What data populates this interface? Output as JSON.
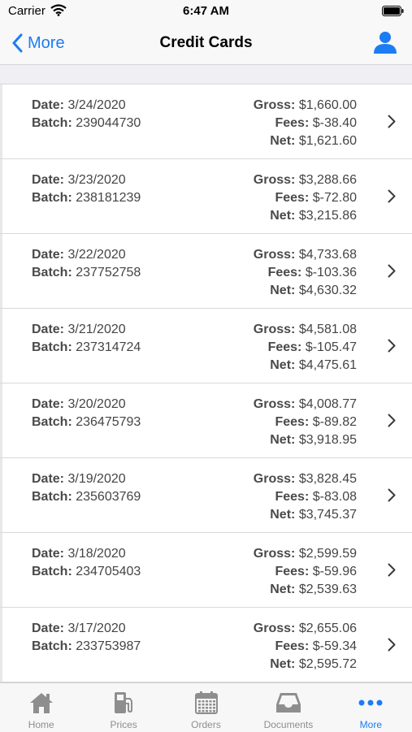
{
  "status_bar": {
    "carrier": "Carrier",
    "time": "6:47 AM"
  },
  "nav": {
    "back_label": "More",
    "title": "Credit Cards"
  },
  "labels": {
    "date": "Date:",
    "batch": "Batch:",
    "gross": "Gross:",
    "fees": "Fees:",
    "net": "Net:"
  },
  "batches": [
    {
      "date": "3/24/2020",
      "batch": "239044730",
      "gross": "$1,660.00",
      "fees": "$-38.40",
      "net": "$1,621.60"
    },
    {
      "date": "3/23/2020",
      "batch": "238181239",
      "gross": "$3,288.66",
      "fees": "$-72.80",
      "net": "$3,215.86"
    },
    {
      "date": "3/22/2020",
      "batch": "237752758",
      "gross": "$4,733.68",
      "fees": "$-103.36",
      "net": "$4,630.32"
    },
    {
      "date": "3/21/2020",
      "batch": "237314724",
      "gross": "$4,581.08",
      "fees": "$-105.47",
      "net": "$4,475.61"
    },
    {
      "date": "3/20/2020",
      "batch": "236475793",
      "gross": "$4,008.77",
      "fees": "$-89.82",
      "net": "$3,918.95"
    },
    {
      "date": "3/19/2020",
      "batch": "235603769",
      "gross": "$3,828.45",
      "fees": "$-83.08",
      "net": "$3,745.37"
    },
    {
      "date": "3/18/2020",
      "batch": "234705403",
      "gross": "$2,599.59",
      "fees": "$-59.96",
      "net": "$2,539.63"
    },
    {
      "date": "3/17/2020",
      "batch": "233753987",
      "gross": "$2,655.06",
      "fees": "$-59.34",
      "net": "$2,595.72"
    }
  ],
  "tabs": [
    {
      "label": "Home",
      "icon": "home-icon",
      "active": false
    },
    {
      "label": "Prices",
      "icon": "fuel-pump-icon",
      "active": false
    },
    {
      "label": "Orders",
      "icon": "calendar-icon",
      "active": false
    },
    {
      "label": "Documents",
      "icon": "inbox-tray-icon",
      "active": false
    },
    {
      "label": "More",
      "icon": "more-dots-icon",
      "active": true
    }
  ],
  "colors": {
    "accent": "#1c7cf4",
    "inactive_tab": "#8e8e8e"
  }
}
